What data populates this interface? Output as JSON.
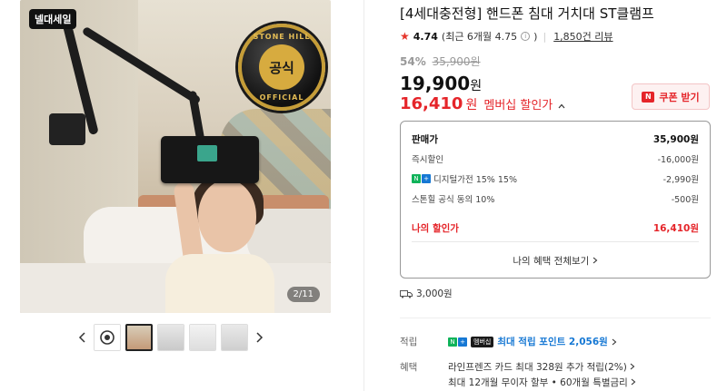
{
  "gallery": {
    "brand_chip": "넬대세일",
    "seal_top": "STONE HILL",
    "seal_center": "공식",
    "seal_bottom": "OFFICIAL",
    "counter": "2/11",
    "prev_icon": "chevron-left-icon",
    "next_icon": "chevron-right-icon"
  },
  "product": {
    "title": "[4세대충전형] 핸드폰 침대 거치대 ST클램프",
    "rating": "4.74",
    "rating_recent": "(최근 6개월 4.75",
    "review_count": "1,850건 리뷰",
    "discount_pct": "54%",
    "original_price": "35,900원",
    "sale_price": "19,900",
    "sale_unit": "원",
    "member_price": "16,410",
    "member_unit": "원",
    "member_label": "멤버십 할인가",
    "coupon_label": "쿠폰 받기"
  },
  "price_box": {
    "rows": [
      {
        "label": "판매가",
        "value": "35,900원"
      },
      {
        "label": "즉시할인",
        "value": "-16,000원"
      },
      {
        "label": "디지털가전 15% 15%",
        "value": "-2,990원"
      },
      {
        "label": "스톤힐 공식 동의 10%",
        "value": "-500원"
      }
    ],
    "my_price_label": "나의 할인가",
    "my_price_value": "16,410원",
    "benefits_link": "나의 혜택 전체보기"
  },
  "shipping": {
    "fee": "3,000원"
  },
  "points": {
    "label": "적립",
    "membership_tag": "멤버십",
    "text": "최대 적립 포인트 2,056원"
  },
  "benefits": {
    "label": "혜택",
    "line1": "라인프렌즈 카드 최대 328원 추가 적립(2%)",
    "line2": "최대 12개월 무이자 할부 • 60개월 특별금리"
  },
  "colors": {
    "accent_red": "#e5252a",
    "naver_green": "#10b35a",
    "link_blue": "#1678d4"
  }
}
